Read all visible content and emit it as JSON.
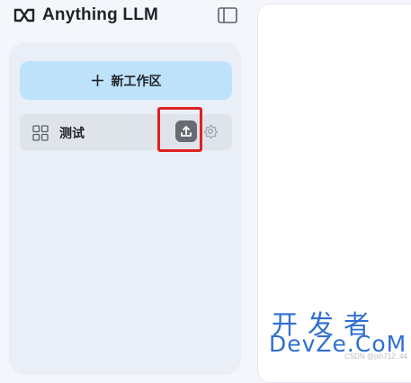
{
  "header": {
    "brand_name": "Anything LLM",
    "logo_icon": "anythingllm-logo-icon",
    "sidebar_toggle_icon": "sidebar-toggle-icon"
  },
  "sidebar": {
    "new_workspace_button": {
      "label": "新工作区",
      "icon": "plus-icon"
    },
    "workspaces": [
      {
        "name": "测试",
        "icon": "grid-icon",
        "actions": [
          {
            "name": "upload",
            "icon": "upload-icon"
          },
          {
            "name": "settings",
            "icon": "gear-icon"
          }
        ]
      }
    ]
  },
  "annotation": {
    "highlight_color": "#e02020"
  },
  "watermark": {
    "small_text": "CSDN @jxh712..44",
    "cn_text": "开发者",
    "en_text": "DevZe.CoM"
  },
  "colors": {
    "new_workspace_bg": "#bfe2fb",
    "workspace_item_bg": "#dfe3ea",
    "watermark": "#2f6fd1"
  }
}
